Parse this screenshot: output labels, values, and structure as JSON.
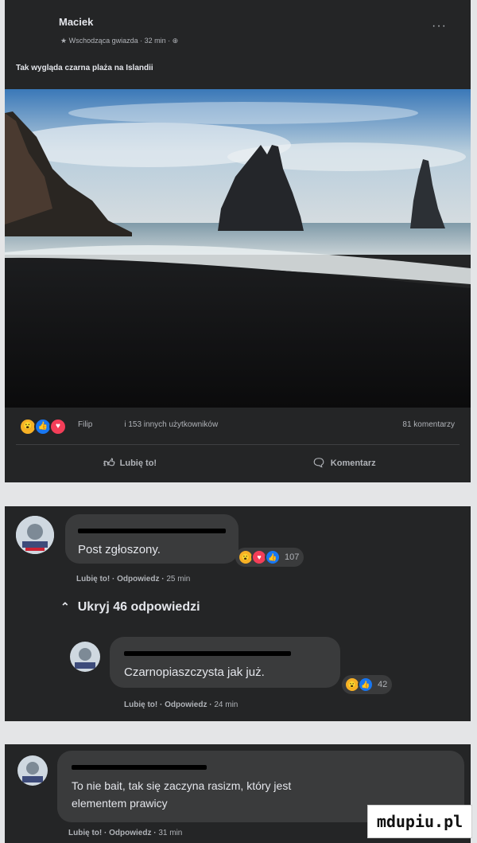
{
  "post": {
    "author": "Maciek",
    "meta": "Wschodząca gwiazda · 32 min · ",
    "text": "Tak wygląda czarna plaża na Islandii",
    "reactions_names": "Filip",
    "reactions_others": "i 153 innych użytkowników",
    "comments_count": "81 komentarzy",
    "like_label": "Lubię to!",
    "comment_label": "Komentarz"
  },
  "comment1": {
    "text": "Post zgłoszony.",
    "reaction_count": "107",
    "like": "Lubię to!",
    "reply": "Odpowiedz",
    "time": "25 min",
    "toggle": "Ukryj 46 odpowiedzi"
  },
  "reply1": {
    "text": "Czarnopiaszczysta jak już.",
    "reaction_count": "42",
    "like": "Lubię to!",
    "reply": "Odpowiedz",
    "time": "24 min"
  },
  "comment2": {
    "text_line1": "To nie bait, tak się zaczyna rasizm, który jest",
    "text_line2": "elementem prawicy",
    "like": "Lubię to!",
    "reply": "Odpowiedz",
    "time": "31 min"
  },
  "watermark": "mdupiu.pl",
  "icons": [
    "more-icon",
    "star-icon",
    "globe-icon",
    "wow-reaction",
    "like-reaction",
    "love-reaction",
    "thumbs-up-icon",
    "comment-icon",
    "chevron-up-icon"
  ],
  "colors": {
    "panel": "#242526",
    "bubble": "#3a3b3c",
    "like": "#1877f2",
    "love": "#f33e58",
    "wow": "#f7b125"
  }
}
